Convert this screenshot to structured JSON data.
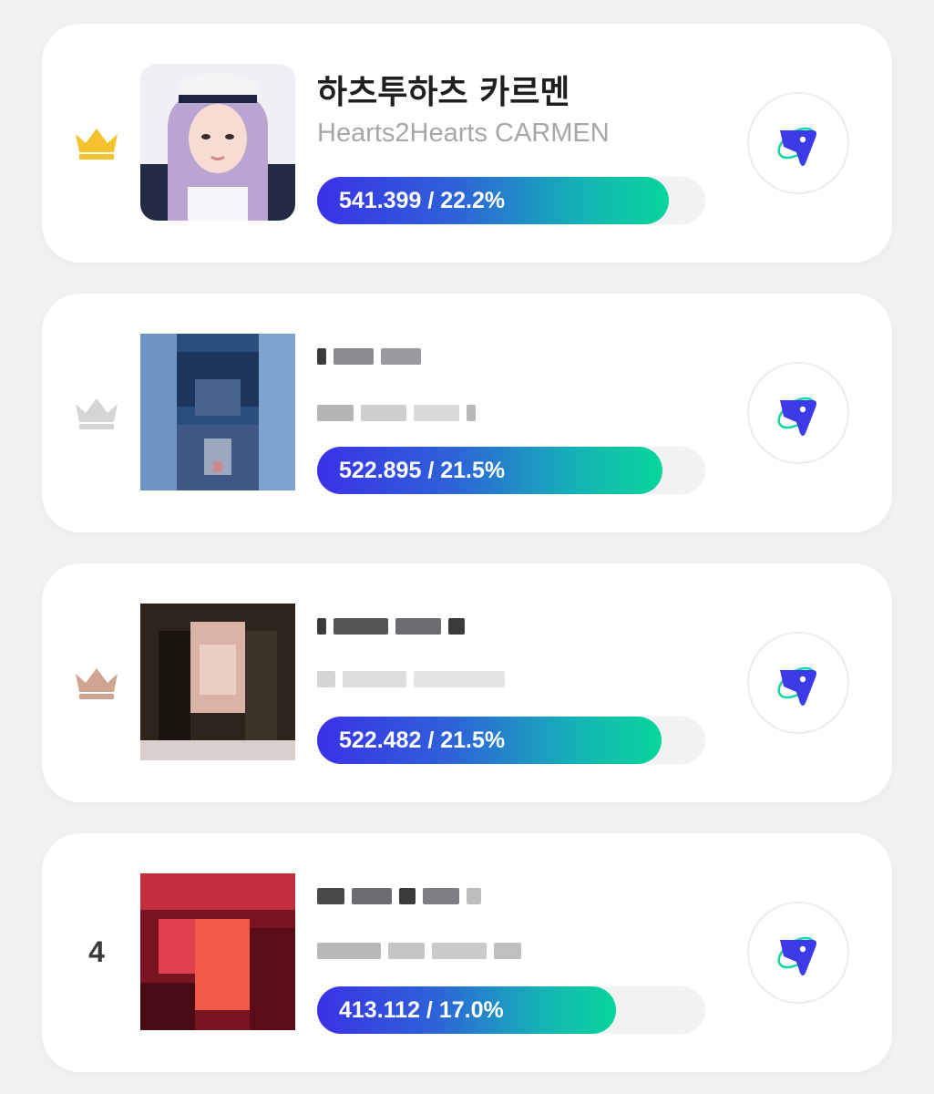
{
  "ranking": [
    {
      "rank_icon": "gold-crown-icon",
      "title": "하츠투하츠 카르멘",
      "subtitle": "Hearts2Hearts CARMEN",
      "bar_label": "541.399 / 22.2%",
      "percent": 22.2,
      "bar_fill_fraction": 0.905,
      "vote_icon": "app-logo-icon"
    },
    {
      "rank_icon": "silver-crown-icon",
      "title": "",
      "subtitle": "",
      "bar_label": "522.895 / 21.5%",
      "percent": 21.5,
      "bar_fill_fraction": 0.889,
      "vote_icon": "app-logo-icon"
    },
    {
      "rank_icon": "bronze-crown-icon",
      "title": "",
      "subtitle": "",
      "bar_label": "522.482 / 21.5%",
      "percent": 21.5,
      "bar_fill_fraction": 0.887,
      "vote_icon": "app-logo-icon"
    },
    {
      "rank_number": "4",
      "title": "",
      "subtitle": "",
      "bar_label": "413.112 / 17.0%",
      "percent": 17.0,
      "bar_fill_fraction": 0.77,
      "vote_icon": "app-logo-icon"
    }
  ],
  "colors": {
    "gold": "#f5c12e",
    "silver": "#d5d5d8",
    "bronze": "#cfa58f",
    "bar_start": "#3a32e6",
    "bar_end": "#07d69a"
  }
}
